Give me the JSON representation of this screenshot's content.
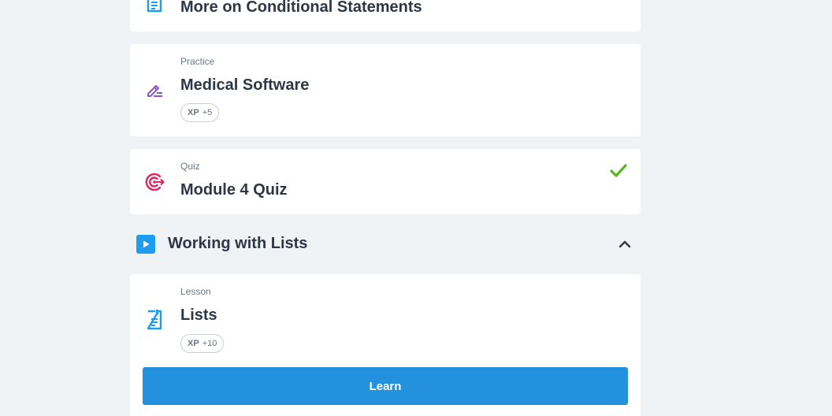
{
  "items": [
    {
      "type_label": "",
      "title": "More on Conditional Statements",
      "icon": "lesson-doc-icon"
    },
    {
      "type_label": "Practice",
      "title": "Medical Software",
      "icon": "pencil-icon",
      "xp": {
        "label": "XP",
        "value": "+5"
      }
    },
    {
      "type_label": "Quiz",
      "title": "Module 4 Quiz",
      "icon": "target-icon",
      "completed": true
    }
  ],
  "section": {
    "title": "Working with Lists",
    "icon": "play-icon",
    "expanded": true
  },
  "lesson": {
    "type_label": "Lesson",
    "title": "Lists",
    "icon": "lesson-doc-icon",
    "xp": {
      "label": "XP",
      "value": "+10"
    },
    "button_label": "Learn"
  },
  "colors": {
    "background": "#f0f3f6",
    "card": "#ffffff",
    "accent_blue": "#1e9cf0",
    "button_blue": "#2491df",
    "practice_purple": "#8b52d6",
    "quiz_red": "#e0245e",
    "check_green": "#5cb518"
  }
}
